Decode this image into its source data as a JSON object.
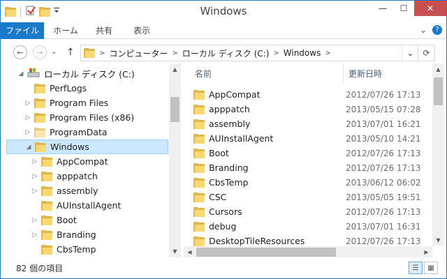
{
  "window": {
    "title": "Windows",
    "minimize": "—",
    "maximize": "☐",
    "close": "✕"
  },
  "ribbon": {
    "tabs": [
      "ファイル",
      "ホーム",
      "共有",
      "表示"
    ],
    "collapse": "⌄",
    "help": "?"
  },
  "address": {
    "crumbs": [
      "コンピューター",
      "ローカル ディスク (C:)",
      "Windows"
    ],
    "dropdown": "⌄",
    "refresh": "⟳"
  },
  "nav_buttons": {
    "back": "←",
    "forward": "→",
    "recent": "⌄",
    "up": "↑"
  },
  "tree": [
    {
      "label": "ローカル ディスク (C:)",
      "arrow": "◢",
      "indent": 0,
      "icon": "drive-icon"
    },
    {
      "label": "PerfLogs",
      "arrow": "",
      "indent": 1,
      "icon": "folder-icon"
    },
    {
      "label": "Program Files",
      "arrow": "▷",
      "indent": 1,
      "icon": "folder-icon"
    },
    {
      "label": "Program Files (x86)",
      "arrow": "▷",
      "indent": 1,
      "icon": "folder-icon"
    },
    {
      "label": "ProgramData",
      "arrow": "▷",
      "indent": 1,
      "icon": "folder-icon-pale"
    },
    {
      "label": "Windows",
      "arrow": "◢",
      "indent": 1,
      "icon": "folder-icon",
      "selected": true
    },
    {
      "label": "AppCompat",
      "arrow": "▷",
      "indent": 2,
      "icon": "folder-icon"
    },
    {
      "label": "apppatch",
      "arrow": "▷",
      "indent": 2,
      "icon": "folder-icon"
    },
    {
      "label": "assembly",
      "arrow": "▷",
      "indent": 2,
      "icon": "folder-icon"
    },
    {
      "label": "AUInstallAgent",
      "arrow": "",
      "indent": 2,
      "icon": "folder-icon"
    },
    {
      "label": "Boot",
      "arrow": "▷",
      "indent": 2,
      "icon": "folder-icon"
    },
    {
      "label": "Branding",
      "arrow": "▷",
      "indent": 2,
      "icon": "folder-icon"
    },
    {
      "label": "CbsTemp",
      "arrow": "",
      "indent": 2,
      "icon": "folder-icon"
    }
  ],
  "columns": {
    "name": "名前",
    "date": "更新日時"
  },
  "files": [
    {
      "name": "AppCompat",
      "date": "2012/07/26 17:13"
    },
    {
      "name": "apppatch",
      "date": "2013/05/15 07:28"
    },
    {
      "name": "assembly",
      "date": "2013/07/01 16:21"
    },
    {
      "name": "AUInstallAgent",
      "date": "2013/05/10 14:21"
    },
    {
      "name": "Boot",
      "date": "2012/07/26 17:13"
    },
    {
      "name": "Branding",
      "date": "2012/07/26 17:13"
    },
    {
      "name": "CbsTemp",
      "date": "2013/06/12 06:02"
    },
    {
      "name": "CSC",
      "date": "2013/05/05 19:51"
    },
    {
      "name": "Cursors",
      "date": "2012/07/26 17:13"
    },
    {
      "name": "debug",
      "date": "2013/07/01 16:31"
    },
    {
      "name": "DesktopTileResources",
      "date": "2012/07/26 17:13"
    }
  ],
  "status": {
    "item_count": "82 個の項目"
  },
  "colors": {
    "accent": "#1979ca",
    "selection": "#cce8ff",
    "folder": "#f8d775",
    "close": "#c75050"
  }
}
